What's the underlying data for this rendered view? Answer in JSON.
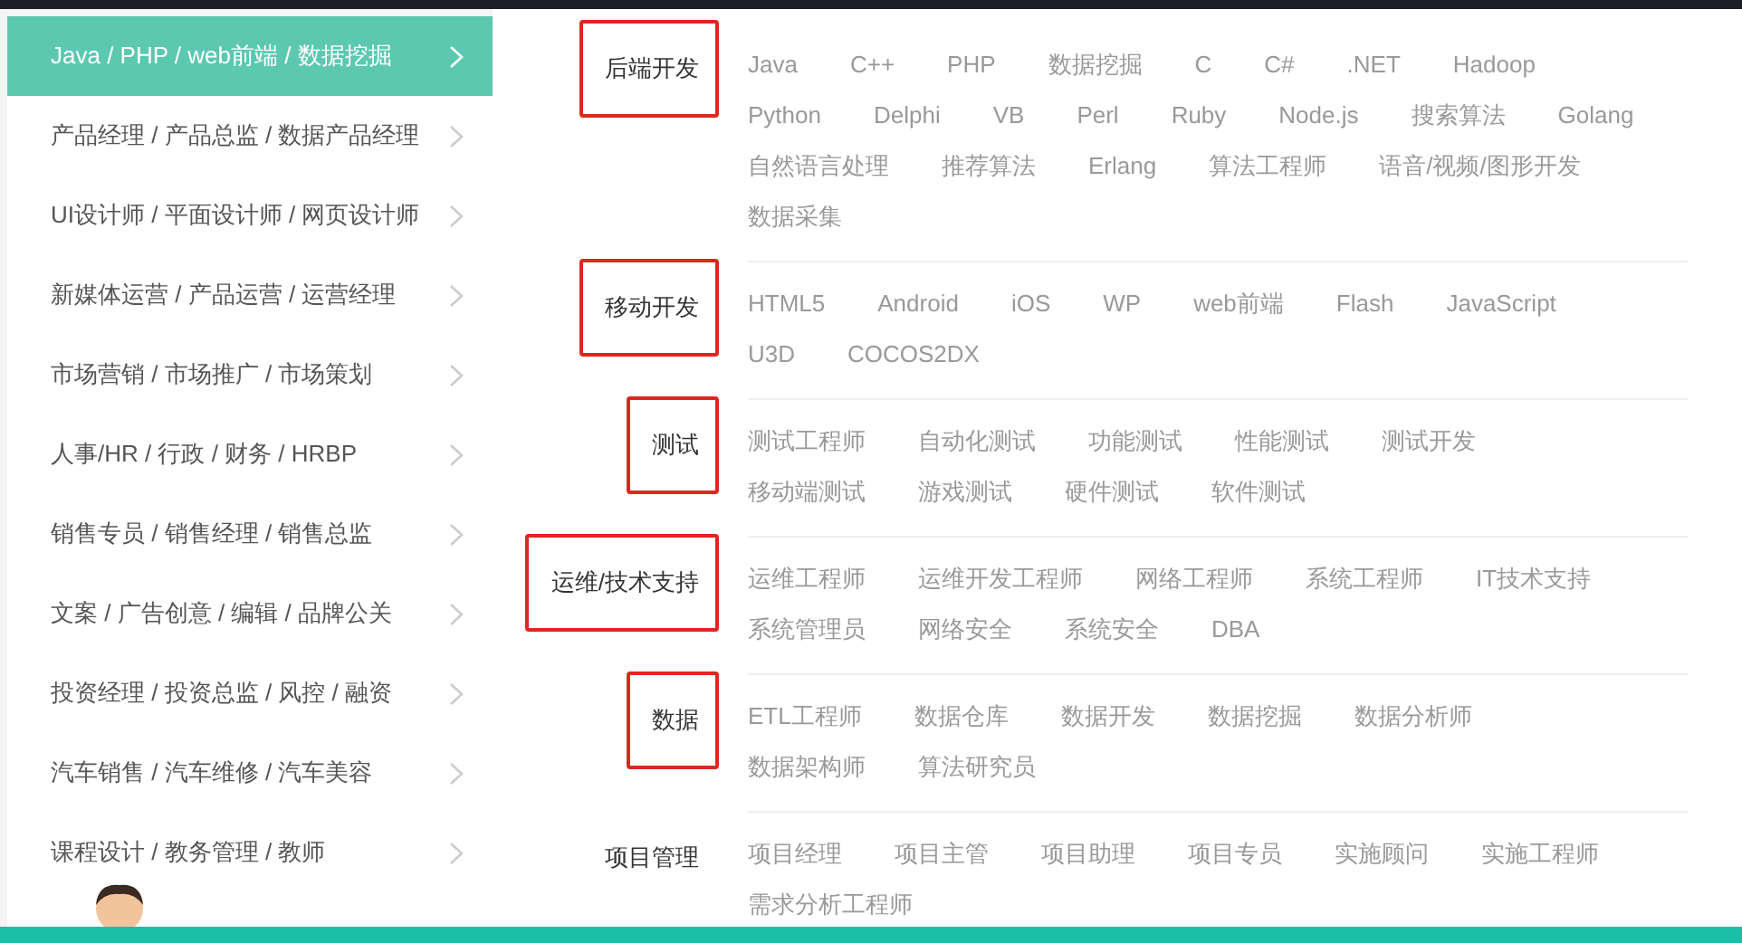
{
  "sidebar": {
    "items": [
      {
        "label": "Java / PHP / web前端 / 数据挖掘",
        "selected": true
      },
      {
        "label": "产品经理 / 产品总监 / 数据产品经理",
        "selected": false
      },
      {
        "label": "UI设计师 / 平面设计师 / 网页设计师",
        "selected": false
      },
      {
        "label": "新媒体运营 / 产品运营 / 运营经理",
        "selected": false
      },
      {
        "label": "市场营销 / 市场推广 / 市场策划",
        "selected": false
      },
      {
        "label": "人事/HR / 行政 / 财务 / HRBP",
        "selected": false
      },
      {
        "label": "销售专员 / 销售经理 / 销售总监",
        "selected": false
      },
      {
        "label": "文案 / 广告创意 / 编辑 / 品牌公关",
        "selected": false
      },
      {
        "label": "投资经理 / 投资总监 / 风控 / 融资",
        "selected": false
      },
      {
        "label": "汽车销售 / 汽车维修 / 汽车美容",
        "selected": false
      },
      {
        "label": "课程设计 / 教务管理 / 教师",
        "selected": false
      }
    ]
  },
  "categories": [
    {
      "title": "后端开发",
      "highlighted": true,
      "tags": [
        "Java",
        "C++",
        "PHP",
        "数据挖掘",
        "C",
        "C#",
        ".NET",
        "Hadoop",
        "Python",
        "Delphi",
        "VB",
        "Perl",
        "Ruby",
        "Node.js",
        "搜索算法",
        "Golang",
        "自然语言处理",
        "推荐算法",
        "Erlang",
        "算法工程师",
        "语音/视频/图形开发",
        "数据采集"
      ]
    },
    {
      "title": "移动开发",
      "highlighted": true,
      "tags": [
        "HTML5",
        "Android",
        "iOS",
        "WP",
        "web前端",
        "Flash",
        "JavaScript",
        "U3D",
        "COCOS2DX"
      ]
    },
    {
      "title": "测试",
      "highlighted": true,
      "tags": [
        "测试工程师",
        "自动化测试",
        "功能测试",
        "性能测试",
        "测试开发",
        "移动端测试",
        "游戏测试",
        "硬件测试",
        "软件测试"
      ]
    },
    {
      "title": "运维/技术支持",
      "highlighted": true,
      "tags": [
        "运维工程师",
        "运维开发工程师",
        "网络工程师",
        "系统工程师",
        "IT技术支持",
        "系统管理员",
        "网络安全",
        "系统安全",
        "DBA"
      ]
    },
    {
      "title": "数据",
      "highlighted": true,
      "tags": [
        "ETL工程师",
        "数据仓库",
        "数据开发",
        "数据挖掘",
        "数据分析师",
        "数据架构师",
        "算法研究员"
      ]
    },
    {
      "title": "项目管理",
      "highlighted": false,
      "tags": [
        "项目经理",
        "项目主管",
        "项目助理",
        "项目专员",
        "实施顾问",
        "实施工程师",
        "需求分析工程师"
      ]
    }
  ]
}
